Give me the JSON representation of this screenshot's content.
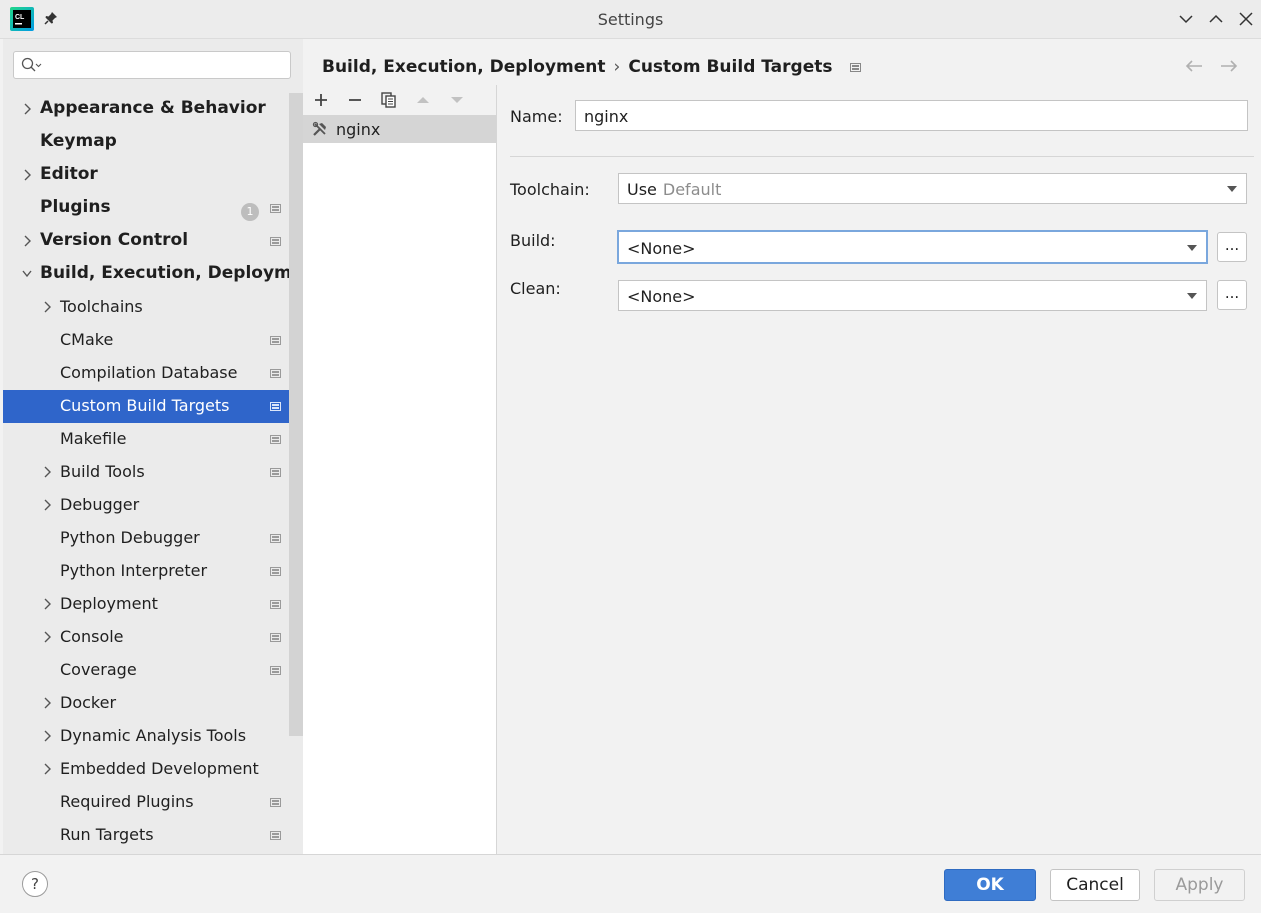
{
  "window": {
    "title": "Settings"
  },
  "search": {
    "placeholder": ""
  },
  "sidebar": {
    "items": [
      {
        "label": "Appearance & Behavior",
        "bold": true,
        "level": 0,
        "expandable": true,
        "expanded": false,
        "project": false
      },
      {
        "label": "Keymap",
        "bold": true,
        "level": 0,
        "expandable": false,
        "project": false
      },
      {
        "label": "Editor",
        "bold": true,
        "level": 0,
        "expandable": true,
        "expanded": false,
        "project": false
      },
      {
        "label": "Plugins",
        "bold": true,
        "level": 0,
        "expandable": false,
        "project": true,
        "badge": "1"
      },
      {
        "label": "Version Control",
        "bold": true,
        "level": 0,
        "expandable": true,
        "expanded": false,
        "project": true
      },
      {
        "label": "Build, Execution, Deploymen",
        "bold": true,
        "level": 0,
        "expandable": true,
        "expanded": true,
        "project": false
      },
      {
        "label": "Toolchains",
        "bold": false,
        "level": 1,
        "expandable": true,
        "expanded": false,
        "project": false
      },
      {
        "label": "CMake",
        "bold": false,
        "level": 1,
        "expandable": false,
        "project": true
      },
      {
        "label": "Compilation Database",
        "bold": false,
        "level": 1,
        "expandable": false,
        "project": true
      },
      {
        "label": "Custom Build Targets",
        "bold": false,
        "level": 1,
        "expandable": false,
        "project": true,
        "selected": true
      },
      {
        "label": "Makefile",
        "bold": false,
        "level": 1,
        "expandable": false,
        "project": true
      },
      {
        "label": "Build Tools",
        "bold": false,
        "level": 1,
        "expandable": true,
        "expanded": false,
        "project": true
      },
      {
        "label": "Debugger",
        "bold": false,
        "level": 1,
        "expandable": true,
        "expanded": false,
        "project": false
      },
      {
        "label": "Python Debugger",
        "bold": false,
        "level": 1,
        "expandable": false,
        "project": true
      },
      {
        "label": "Python Interpreter",
        "bold": false,
        "level": 1,
        "expandable": false,
        "project": true
      },
      {
        "label": "Deployment",
        "bold": false,
        "level": 1,
        "expandable": true,
        "expanded": false,
        "project": true
      },
      {
        "label": "Console",
        "bold": false,
        "level": 1,
        "expandable": true,
        "expanded": false,
        "project": true
      },
      {
        "label": "Coverage",
        "bold": false,
        "level": 1,
        "expandable": false,
        "project": true
      },
      {
        "label": "Docker",
        "bold": false,
        "level": 1,
        "expandable": true,
        "expanded": false,
        "project": false
      },
      {
        "label": "Dynamic Analysis Tools",
        "bold": false,
        "level": 1,
        "expandable": true,
        "expanded": false,
        "project": false
      },
      {
        "label": "Embedded Development",
        "bold": false,
        "level": 1,
        "expandable": true,
        "expanded": false,
        "project": false
      },
      {
        "label": "Required Plugins",
        "bold": false,
        "level": 1,
        "expandable": false,
        "project": true
      },
      {
        "label": "Run Targets",
        "bold": false,
        "level": 1,
        "expandable": false,
        "project": true
      }
    ]
  },
  "breadcrumb": {
    "parent": "Build, Execution, Deployment",
    "separator": "›",
    "current": "Custom Build Targets"
  },
  "targets": {
    "items": [
      "nginx"
    ]
  },
  "form": {
    "name_label": "Name:",
    "name_value": "nginx",
    "toolchain_label": "Toolchain:",
    "toolchain_value": "Use",
    "toolchain_hint": "Default",
    "build_label": "Build:",
    "build_value": "<None>",
    "clean_label": "Clean:",
    "clean_value": "<None>",
    "ellipsis": "..."
  },
  "footer": {
    "help": "?",
    "ok": "OK",
    "cancel": "Cancel",
    "apply": "Apply"
  },
  "colors": {
    "selection": "#2f65ca",
    "ok_button": "#3f7ed6",
    "focus_border": "#7aa7dd"
  }
}
